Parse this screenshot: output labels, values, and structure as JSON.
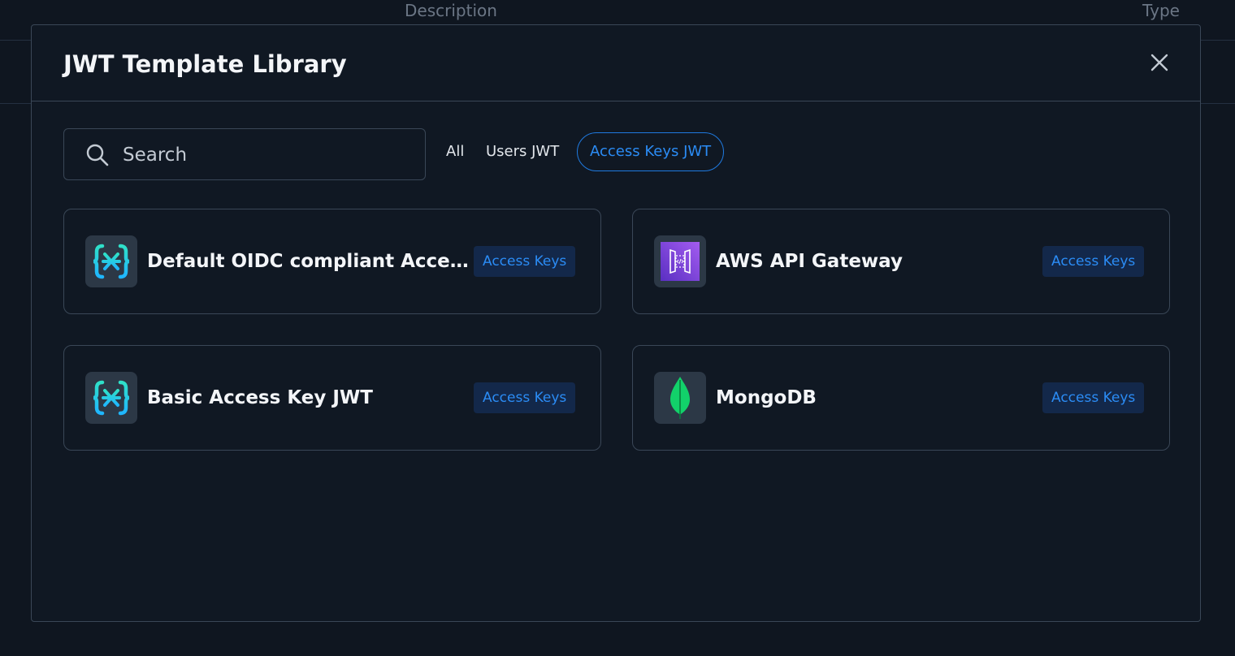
{
  "background": {
    "columns": [
      "Description",
      "Type"
    ]
  },
  "modal": {
    "title": "JWT Template Library",
    "close_icon": "close-icon",
    "search": {
      "placeholder": "Search",
      "value": "",
      "icon": "search-icon"
    },
    "filters": [
      {
        "label": "All",
        "active": false
      },
      {
        "label": "Users JWT",
        "active": false
      },
      {
        "label": "Access Keys JWT",
        "active": true
      }
    ],
    "templates": [
      {
        "title": "Default OIDC compliant Access Key JWT",
        "badge": "Access Keys",
        "icon": "descope-logo-icon"
      },
      {
        "title": "AWS API Gateway",
        "badge": "Access Keys",
        "icon": "aws-api-gateway-icon"
      },
      {
        "title": "Basic Access Key JWT",
        "badge": "Access Keys",
        "icon": "descope-logo-icon"
      },
      {
        "title": "MongoDB",
        "badge": "Access Keys",
        "icon": "mongodb-leaf-icon"
      }
    ]
  },
  "colors": {
    "background": "#0f1620",
    "modal": "#101823",
    "border": "#3a4757",
    "accent": "#2b8cf5",
    "badge_bg": "#13284a",
    "aws_purple": "#7b3fd6",
    "mongo_green": "#12d16a"
  }
}
